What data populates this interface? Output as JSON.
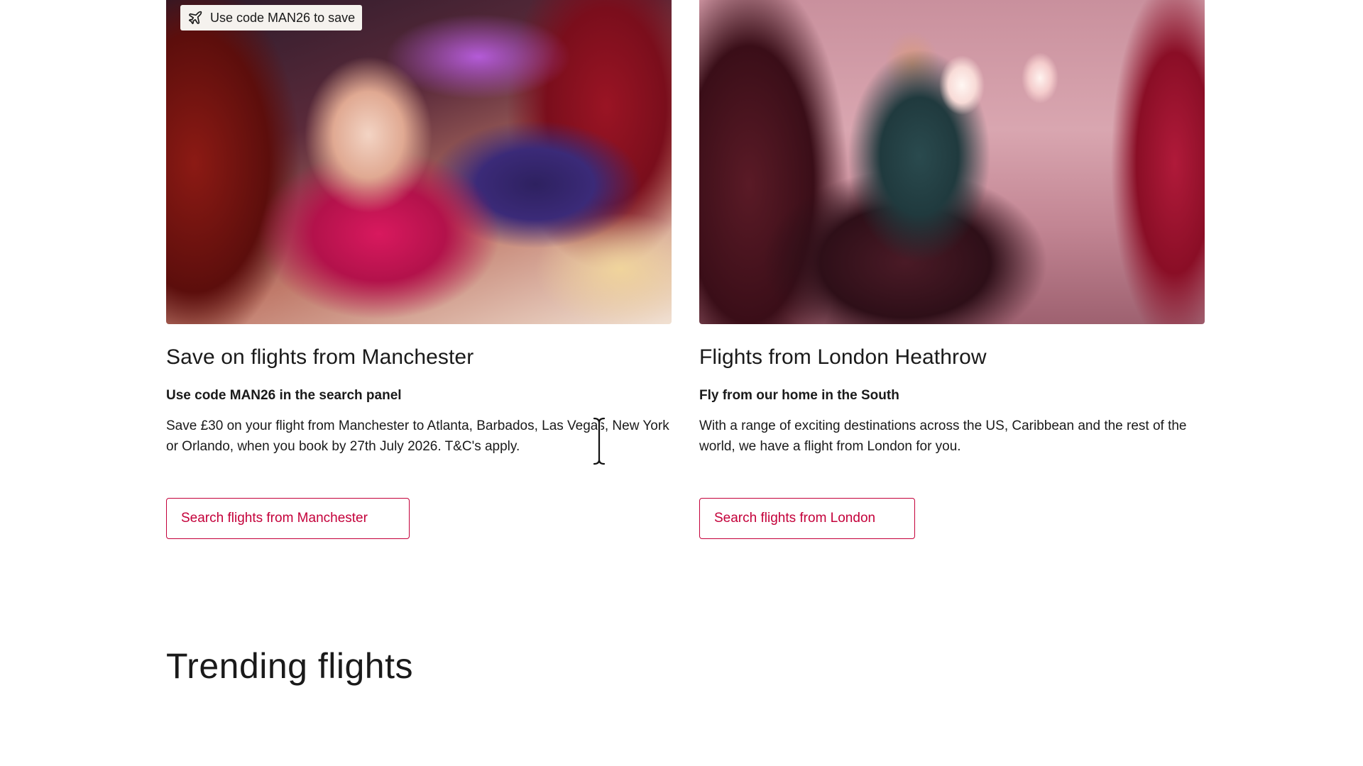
{
  "cards": [
    {
      "badge": {
        "icon": "plane-icon",
        "text": "Use code MAN26 to save"
      },
      "title": "Save on flights from Manchester",
      "subtitle": "Use code MAN26 in the search panel",
      "body": "Save £30 on your flight from Manchester to Atlanta, Barbados, Las Vegas, New York or Orlando, when you book by 27th July 2026. T&C's apply.",
      "cta_label": "Search flights from Manchester"
    },
    {
      "title": "Flights from London Heathrow",
      "subtitle": "Fly from our home in the South",
      "body": "With a range of exciting destinations across the US, Caribbean and the rest of the world, we have a flight from London for you.",
      "cta_label": "Search flights from London"
    }
  ],
  "trending": {
    "title": "Trending flights"
  },
  "colors": {
    "accent": "#c4003a",
    "text": "#1a1a1a",
    "badge_bg": "#f5f2ee"
  }
}
